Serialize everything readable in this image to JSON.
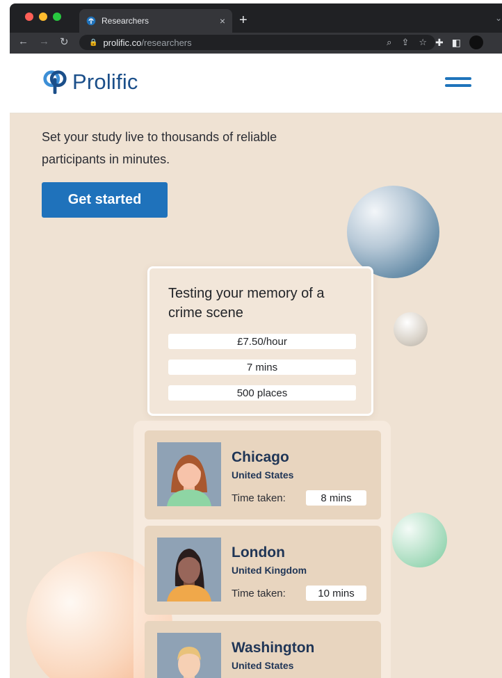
{
  "browser": {
    "tab_title": "Researchers",
    "tab_close": "×",
    "new_tab": "+",
    "url_host": "prolific.co",
    "url_path": "/researchers",
    "traffic_colors": [
      "#ff5f57",
      "#febc2e",
      "#28c840"
    ]
  },
  "header": {
    "logo_text": "Prolific",
    "brand_color": "#1b4f8a",
    "accent_color": "#1f72bb"
  },
  "hero": {
    "tagline": "Set your study live to thousands of reliable participants in minutes.",
    "cta_label": "Get started",
    "background_color": "#efe2d3"
  },
  "study_card": {
    "title": "Testing your memory of a crime scene",
    "pay": "£7.50/hour",
    "duration": "7 mins",
    "places": "500 places"
  },
  "results": [
    {
      "city": "Chicago",
      "country": "United States",
      "time_label": "Time taken:",
      "time_value": "8 mins"
    },
    {
      "city": "London",
      "country": "United Kingdom",
      "time_label": "Time taken:",
      "time_value": "10 mins"
    },
    {
      "city": "Washington",
      "country": "United States",
      "time_label": "",
      "time_value": ""
    }
  ]
}
